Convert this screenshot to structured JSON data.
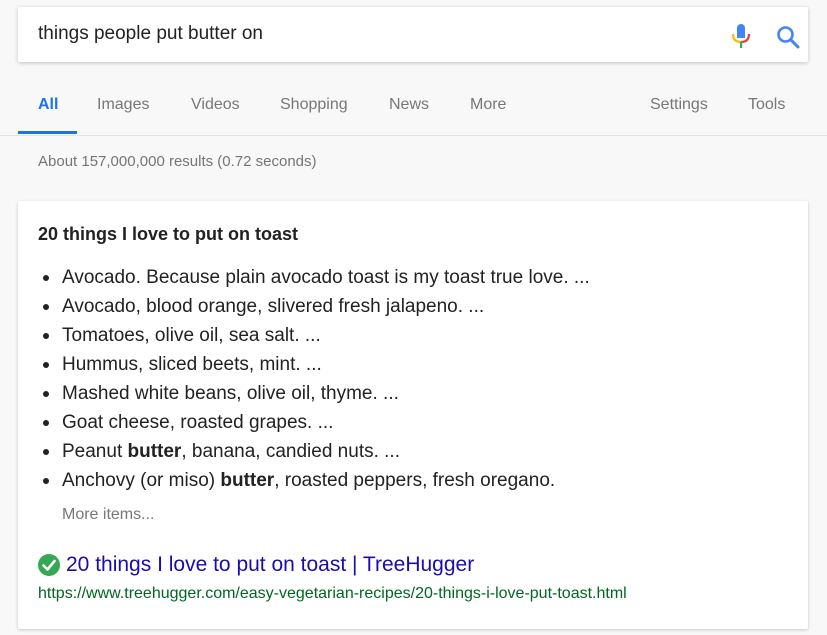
{
  "search": {
    "query": "things people put butter on"
  },
  "tabs": [
    {
      "label": "All"
    },
    {
      "label": "Images"
    },
    {
      "label": "Videos"
    },
    {
      "label": "Shopping"
    },
    {
      "label": "News"
    },
    {
      "label": "More"
    },
    {
      "label": "Settings"
    },
    {
      "label": "Tools"
    }
  ],
  "stats": "About 157,000,000 results (0.72 seconds)",
  "snippet": {
    "title": "20 things I love to put on toast",
    "items": [
      {
        "before": "Avocado. Because plain avocado toast is my toast true love. ...",
        "bold": "",
        "after": ""
      },
      {
        "before": "Avocado, blood orange, slivered fresh jalapeno. ...",
        "bold": "",
        "after": ""
      },
      {
        "before": "Tomatoes, olive oil, sea salt. ...",
        "bold": "",
        "after": ""
      },
      {
        "before": "Hummus, sliced beets, mint. ...",
        "bold": "",
        "after": ""
      },
      {
        "before": "Mashed white beans, olive oil, thyme. ...",
        "bold": "",
        "after": ""
      },
      {
        "before": "Goat cheese, roasted grapes. ...",
        "bold": "",
        "after": ""
      },
      {
        "before": "Peanut ",
        "bold": "butter",
        "after": ", banana, candied nuts. ..."
      },
      {
        "before": "Anchovy (or miso) ",
        "bold": "butter",
        "after": ", roasted peppers, fresh oregano."
      }
    ],
    "more_label": "More items...",
    "result_title": "20 things I love to put on toast | TreeHugger",
    "result_url": "https://www.treehugger.com/easy-vegetarian-recipes/20-things-i-love-put-toast.html"
  },
  "colors": {
    "accent": "#1a73e8",
    "link": "#1a0dab",
    "url": "#006621",
    "check": "#34a853"
  },
  "icons": {
    "mic": "microphone-icon",
    "search": "search-icon",
    "verified": "check-circle-icon"
  }
}
